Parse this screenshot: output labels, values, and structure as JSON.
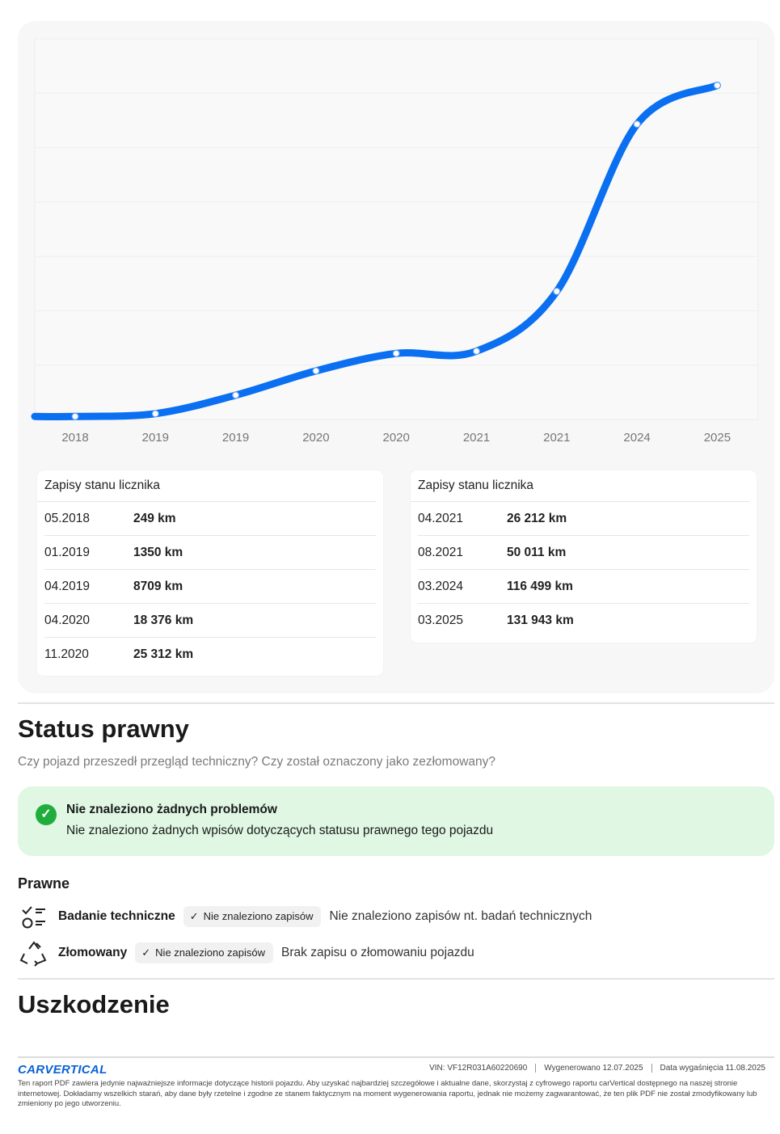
{
  "chart_data": {
    "type": "line",
    "categories": [
      "2018",
      "2019",
      "2019",
      "2020",
      "2020",
      "2021",
      "2021",
      "2024",
      "2025"
    ],
    "values": [
      249,
      1350,
      8709,
      18376,
      25312,
      26212,
      50011,
      116499,
      131943
    ],
    "title": "",
    "xlabel": "",
    "ylabel": "",
    "grid": true,
    "colors": {
      "line": "#0a6ff0",
      "marker_fill": "#ffffff"
    }
  },
  "odometer": {
    "left_table": {
      "header": "Zapisy stanu licznika",
      "rows": [
        {
          "date": "05.2018",
          "km": "249 km"
        },
        {
          "date": "01.2019",
          "km": "1350 km"
        },
        {
          "date": "04.2019",
          "km": "8709 km"
        },
        {
          "date": "04.2020",
          "km": "18 376 km"
        },
        {
          "date": "11.2020",
          "km": "25 312 km"
        }
      ]
    },
    "right_table": {
      "header": "Zapisy stanu licznika",
      "rows": [
        {
          "date": "04.2021",
          "km": "26 212 km"
        },
        {
          "date": "08.2021",
          "km": "50 011 km"
        },
        {
          "date": "03.2024",
          "km": "116 499 km"
        },
        {
          "date": "03.2025",
          "km": "131 943 km"
        }
      ]
    }
  },
  "legal": {
    "title": "Status prawny",
    "subtitle": "Czy pojazd przeszedł przegląd techniczny? Czy został oznaczony jako zezłomowany?",
    "ok_title": "Nie znaleziono żadnych problemów",
    "ok_text": "Nie znaleziono żadnych wpisów dotyczących statusu prawnego tego pojazdu",
    "section_title": "Prawne",
    "items": [
      {
        "label": "Badanie techniczne",
        "status": "Nie znaleziono zapisów",
        "desc": "Nie znaleziono zapisów nt. badań technicznych"
      },
      {
        "label": "Złomowany",
        "status": "Nie znaleziono zapisów",
        "desc": "Brak zapisu o złomowaniu pojazdu"
      }
    ]
  },
  "damage": {
    "title": "Uszkodzenie"
  },
  "footer": {
    "logo": "CARVERTICAL",
    "vin": "VIN:  VF12R031A60220690",
    "generated": "Wygenerowano  12.07.2025",
    "expires": "Data wygaśnięcia  11.08.2025",
    "disclaimer": "Ten raport PDF zawiera jedynie najważniejsze informacje dotyczące historii pojazdu. Aby uzyskać najbardziej szczegółowe i aktualne dane, skorzystaj z cyfrowego raportu carVertical dostępnego na naszej stronie internetowej. Dokładamy wszelkich starań, aby dane były rzetelne i zgodne ze stanem faktycznym na moment wygenerowania raportu, jednak nie możemy zagwarantować, że ten plik PDF nie został zmodyfikowany lub zmieniony po jego utworzeniu."
  }
}
